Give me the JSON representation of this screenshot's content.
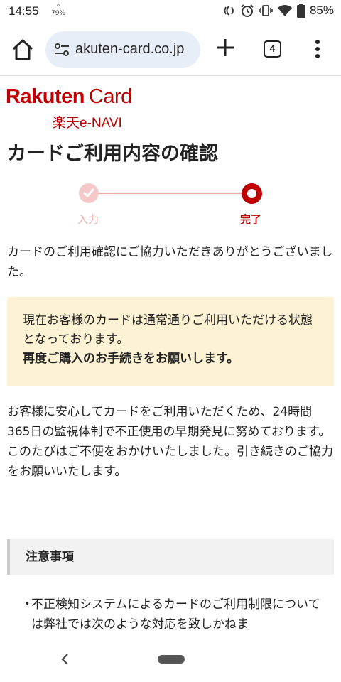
{
  "status_bar": {
    "time": "14:55",
    "small_text": "79%",
    "battery": "85%"
  },
  "browser": {
    "url": "akuten-card.co.jp",
    "tab_count": "4"
  },
  "logo": {
    "main_left": "Rakuten",
    "main_right": "Card",
    "sub": "楽天e-NAVI"
  },
  "page": {
    "title": "カードご利用内容の確認",
    "steps": [
      {
        "label": "入力",
        "state": "done"
      },
      {
        "label": "完了",
        "state": "current"
      }
    ],
    "intro": "カードのご利用確認にご協力いただきありがとうございました。",
    "notice_line1": "現在お客様のカードは通常通りご利用いただける状態となっております。",
    "notice_line2": "再度ご購入のお手続きをお願いします。",
    "body_para1": "お客様に安心してカードをご利用いただくため、24時間365日の監視体制で不正使用の早期発見に努めております。",
    "body_para2": "このたびはご不便をおかけいたしました。引き続きのご協力をお願いいたします。",
    "caution_heading": "注意事項",
    "caution_bullet": "・",
    "caution_item": "不正検知システムによるカードのご利用制限については弊社では次のような対応を致しかねま"
  },
  "colors": {
    "brand_red": "#bf0000",
    "notice_bg": "#fdf2d4",
    "url_bg": "#e8eef8"
  }
}
